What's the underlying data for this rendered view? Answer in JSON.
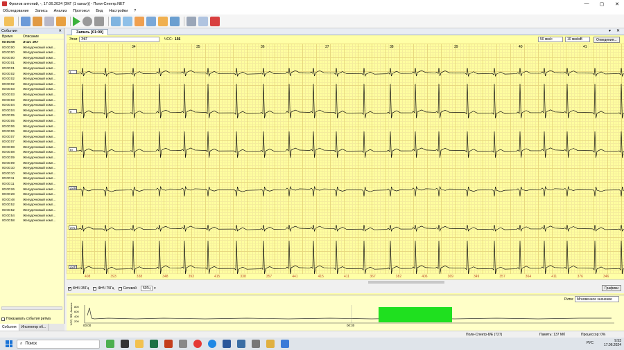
{
  "window": {
    "title": "Фролов антоний, -, 17.06.2024 [ЭКГ (1 канал)] - Поли-Спектр.NET",
    "controls": [
      "—",
      "▢",
      "✕"
    ]
  },
  "menu": [
    "Обследование",
    "Запись",
    "Анализ",
    "Протокол",
    "Вид",
    "Настройки",
    "?"
  ],
  "events_panel": {
    "title": "События",
    "col_time": "Время",
    "col_desc": "Описание",
    "rows": [
      {
        "time": "00:00:00",
        "desc": "Этап: ЭКГ"
      },
      {
        "time": "00:00:00",
        "desc": "Желудочковый комп..."
      },
      {
        "time": "00:00:00",
        "desc": "Желудочковый комп..."
      },
      {
        "time": "00:00:00",
        "desc": "Желудочковый комп..."
      },
      {
        "time": "00:00:01",
        "desc": "Желудочковый комп..."
      },
      {
        "time": "00:00:01",
        "desc": "Желудочковый комп..."
      },
      {
        "time": "00:00:02",
        "desc": "Желудочковый комп..."
      },
      {
        "time": "00:00:02",
        "desc": "Желудочковый комп..."
      },
      {
        "time": "00:00:02",
        "desc": "Желудочковый комп..."
      },
      {
        "time": "00:00:03",
        "desc": "Желудочковый комп..."
      },
      {
        "time": "00:00:03",
        "desc": "Желудочковый комп..."
      },
      {
        "time": "00:00:03",
        "desc": "Желудочковый комп..."
      },
      {
        "time": "00:00:04",
        "desc": "Желудочковый комп..."
      },
      {
        "time": "00:00:04",
        "desc": "Желудочковый комп..."
      },
      {
        "time": "00:00:05",
        "desc": "Желудочковый комп..."
      },
      {
        "time": "00:00:05",
        "desc": "Желудочковый комп..."
      },
      {
        "time": "00:00:06",
        "desc": "Желудочковый комп..."
      },
      {
        "time": "00:00:06",
        "desc": "Желудочковый комп..."
      },
      {
        "time": "00:00:07",
        "desc": "Желудочковый комп..."
      },
      {
        "time": "00:00:07",
        "desc": "Желудочковый комп..."
      },
      {
        "time": "00:00:08",
        "desc": "Желудочковый комп..."
      },
      {
        "time": "00:00:08",
        "desc": "Желудочковый комп..."
      },
      {
        "time": "00:00:09",
        "desc": "Желудочковый комп..."
      },
      {
        "time": "00:00:09",
        "desc": "Желудочковый комп..."
      },
      {
        "time": "00:00:10",
        "desc": "Желудочковый комп..."
      },
      {
        "time": "00:00:10",
        "desc": "Желудочковый комп..."
      },
      {
        "time": "00:00:11",
        "desc": "Желудочковый комп..."
      },
      {
        "time": "00:00:11",
        "desc": "Желудочковый комп..."
      },
      {
        "time": "00:00:26",
        "desc": "Желудочковый комп..."
      },
      {
        "time": "00:00:28",
        "desc": "Желудочковый комп..."
      },
      {
        "time": "00:00:48",
        "desc": "Желудочковый комп..."
      },
      {
        "time": "00:00:52",
        "desc": "Желудочковый комп..."
      },
      {
        "time": "00:00:52",
        "desc": "Желудочковый комп..."
      },
      {
        "time": "00:00:54",
        "desc": "Желудочковый комп..."
      },
      {
        "time": "00:00:58",
        "desc": "Желудочковый комп..."
      }
    ],
    "show_rhythm_label": "Показывать события ритма",
    "tab_events": "События",
    "tab_inspector": "Инспектор об..."
  },
  "document_tab": "Запись [01:00]",
  "ecg": {
    "stage_label": "Этап:",
    "stage_value": "ЭКГ",
    "hr_label": "ЧСС:",
    "hr_value": "156",
    "speed": "50 мм/с",
    "gain": "10 мм/мВ",
    "leads_button": "Отведения...",
    "seconds": [
      "34",
      "35",
      "36",
      "37",
      "38",
      "39",
      "40",
      "41"
    ],
    "leads": [
      "I",
      "II",
      "III",
      "aVR",
      "aVL",
      "aVF"
    ],
    "rr_intervals": [
      "408",
      "393",
      "338",
      "348",
      "393",
      "415",
      "338",
      "357",
      "441",
      "415",
      "411",
      "367",
      "382",
      "406",
      "369",
      "349",
      "357",
      "364",
      "411",
      "376",
      "346"
    ]
  },
  "filters": {
    "hf35": "ФНЧ 35Гц",
    "hf75": "ФНЧ 75Гц",
    "mains": "Сетевой",
    "mains_value": "50Гц",
    "charts_button": "Графики"
  },
  "trend": {
    "y_label": "ЧСС, RR, Амплит.",
    "y_ticks": [
      "800",
      "600",
      "400",
      "200"
    ],
    "rhythm_label": "Ритм:",
    "rhythm_value": "Мгновенное значение",
    "time_ticks": [
      "00:00",
      "00:30"
    ]
  },
  "status": {
    "device": "Поли-Спектр-8/Е (727)",
    "memory": "Память: 137 Мб",
    "cpu": "Процессор: 0%"
  },
  "taskbar": {
    "search": "Поиск",
    "lang": "РУС",
    "time": "9:53",
    "date": "17.06.2024"
  }
}
